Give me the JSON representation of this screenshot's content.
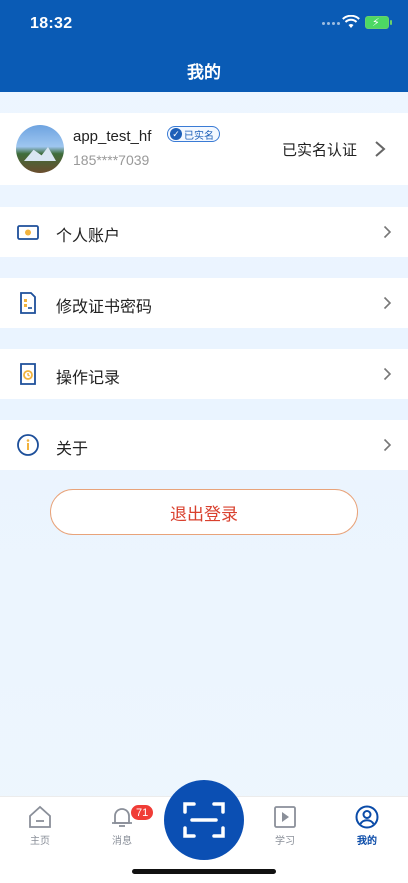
{
  "status_bar": {
    "time": "18:32"
  },
  "header": {
    "title": "我的"
  },
  "profile": {
    "username": "app_test_hf",
    "badge": "已实名",
    "phone": "185****7039",
    "auth_status": "已实名认证"
  },
  "menu": [
    {
      "label": "个人账户",
      "icon": "wallet-icon"
    },
    {
      "label": "修改证书密码",
      "icon": "certificate-icon"
    },
    {
      "label": "操作记录",
      "icon": "record-icon"
    },
    {
      "label": "关于",
      "icon": "info-icon"
    }
  ],
  "logout_label": "退出登录",
  "tabbar": {
    "home": "主页",
    "messages": "消息",
    "messages_badge": "71",
    "study": "学习",
    "mine": "我的"
  },
  "colors": {
    "primary": "#0a5bb5",
    "danger": "#d9402e",
    "active_tab": "#0a4ba8"
  }
}
